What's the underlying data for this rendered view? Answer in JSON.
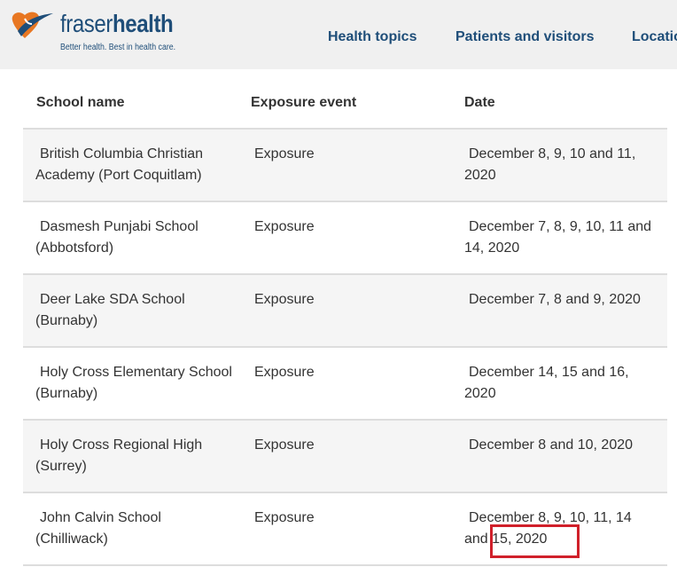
{
  "header": {
    "logo_light": "fraser",
    "logo_bold": "health",
    "tagline": "Better health. Best in health care.",
    "nav": [
      "Health topics",
      "Patients and visitors",
      "Locatio"
    ]
  },
  "colors": {
    "brand_blue": "#1f4e79",
    "brand_orange": "#e87722",
    "highlight_red": "#d0202a"
  },
  "table": {
    "headers": [
      "School name",
      "Exposure event",
      "Date"
    ],
    "rows": [
      {
        "school": "British Columbia Christian Academy (Port Coquitlam)",
        "event": "Exposure",
        "date": "December 8, 9, 10 and 11, 2020"
      },
      {
        "school": "Dasmesh Punjabi School (Abbotsford)",
        "event": "Exposure",
        "date": "December 7, 8, 9, 10, 11 and 14, 2020"
      },
      {
        "school": "Deer Lake SDA School (Burnaby)",
        "event": "Exposure",
        "date": "December 7, 8 and 9, 2020"
      },
      {
        "school": "Holy Cross Elementary School (Burnaby)",
        "event": "Exposure",
        "date": "December 14, 15 and 16, 2020"
      },
      {
        "school": "Holy Cross Regional High (Surrey)",
        "event": "Exposure",
        "date": "December 8 and 10, 2020"
      },
      {
        "school": "John Calvin School (Chilliwack)",
        "event": "Exposure",
        "date": "December 8, 9, 10, 11, 14 and 15, 2020"
      }
    ]
  }
}
